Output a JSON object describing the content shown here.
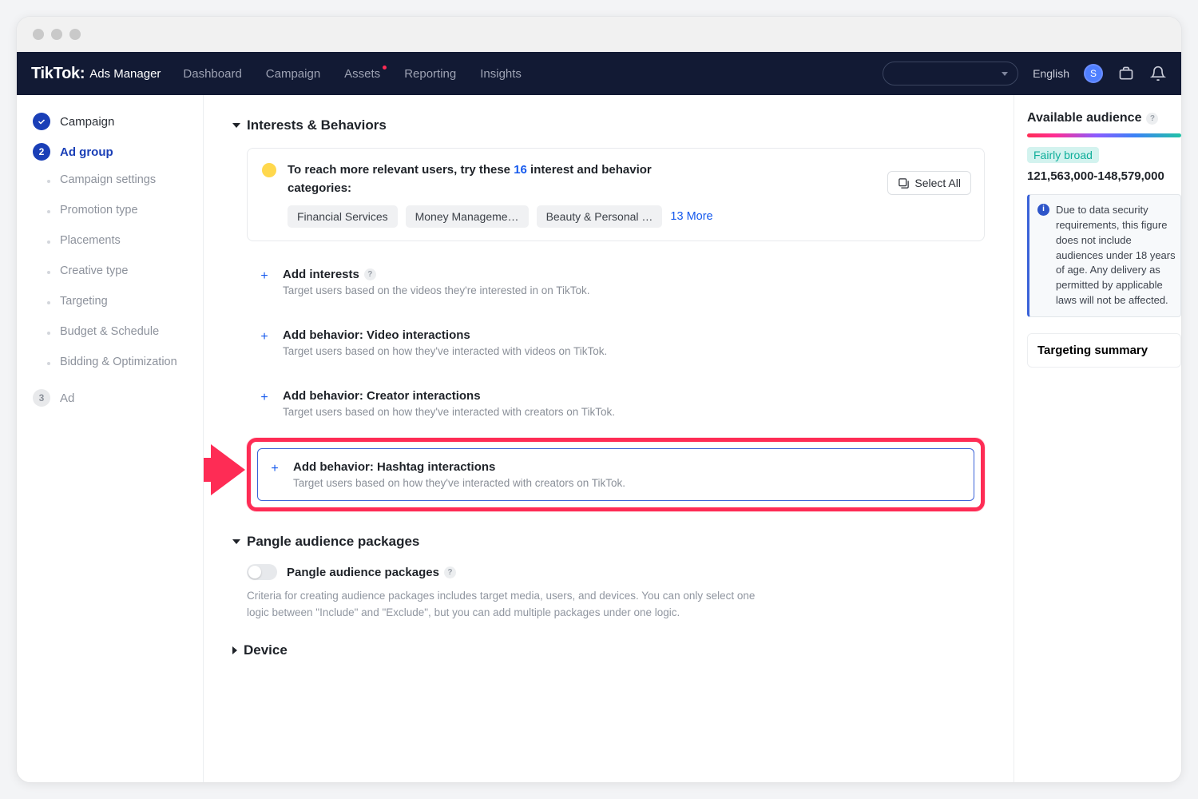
{
  "brand": {
    "name": "TikTok",
    "product": "Ads Manager"
  },
  "nav": {
    "dashboard": "Dashboard",
    "campaign": "Campaign",
    "assets": "Assets",
    "reporting": "Reporting",
    "insights": "Insights"
  },
  "topright": {
    "language": "English",
    "avatar_initial": "S"
  },
  "sidebar": {
    "steps": [
      {
        "label": "Campaign",
        "state": "done"
      },
      {
        "label": "Ad group",
        "state": "active"
      },
      {
        "label": "Ad",
        "state": "pending",
        "num": "3"
      }
    ],
    "subs": [
      "Campaign settings",
      "Promotion type",
      "Placements",
      "Creative type",
      "Targeting",
      "Budget & Schedule",
      "Bidding & Optimization"
    ]
  },
  "section": {
    "interests_title": "Interests & Behaviors",
    "reco_prefix": "To reach more relevant users, try these ",
    "reco_count": "16",
    "reco_suffix": " interest and behavior categories:",
    "chips": [
      "Financial Services",
      "Money Manageme…",
      "Beauty & Personal …"
    ],
    "more": "13 More",
    "select_all": "Select All",
    "rows": [
      {
        "title": "Add interests",
        "desc": "Target users based on the videos they're interested in on TikTok.",
        "info": true
      },
      {
        "title": "Add behavior: Video interactions",
        "desc": "Target users based on how they've interacted with videos on TikTok."
      },
      {
        "title": "Add behavior: Creator interactions",
        "desc": "Target users based on how they've interacted with creators on TikTok."
      },
      {
        "title": "Add behavior: Hashtag interactions",
        "desc": "Target users based on how they've interacted with creators on TikTok."
      }
    ],
    "pangle_title": "Pangle audience packages",
    "pangle_toggle_label": "Pangle audience packages",
    "pangle_desc": "Criteria for creating audience packages includes target media, users, and devices. You can only select one logic between \"Include\" and \"Exclude\", but you can add multiple packages under one logic.",
    "device_title": "Device"
  },
  "right": {
    "title": "Available audience",
    "broad": "Fairly broad",
    "range": "121,563,000-148,579,000",
    "notice": "Due to data security requirements, this figure does not include audiences under 18 years of age. Any delivery as permitted by applicable laws will not be affected.",
    "targeting_summary": "Targeting summary"
  }
}
